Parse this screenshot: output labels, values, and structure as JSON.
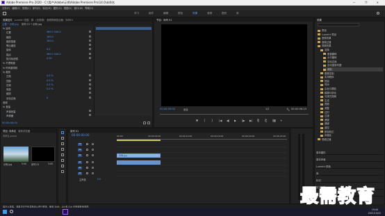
{
  "window": {
    "title": "Adobe Premiere Pro 2020 - C:\\用户\\Adobe\\示例\\Adobe Premiere Pro\\14.0\\未命名",
    "controls": "— ❐ ✕"
  },
  "menu": [
    "文件(F)",
    "编辑(E)",
    "剪辑(C)",
    "序列(S)",
    "标记(M)",
    "图形(G)",
    "视图(V)",
    "窗口(W)",
    "帮助(H)"
  ],
  "workspaces": [
    "学习",
    "组件",
    "编辑",
    "颜色",
    "效果",
    "音频",
    "图形",
    "库"
  ],
  "workspace_active": "效果",
  "effect_controls": {
    "tabs": [
      "效果控件",
      "Lumetri 范围",
      "源：(无剪辑)",
      "音频剪辑混合器：序列01"
    ],
    "header": [
      "主要 * 示例.jpg",
      "序列 01 * 示例.jpg"
    ],
    "rows": [
      {
        "label": "fx 运动",
        "value": ""
      },
      {
        "label": "位置",
        "value": "960.0   540.0"
      },
      {
        "label": "缩放",
        "value": "100.0"
      },
      {
        "label": "缩放宽度",
        "value": "100.0"
      },
      {
        "label": "等比缩放",
        "value": ""
      },
      {
        "label": "旋转",
        "value": "0.0"
      },
      {
        "label": "锚点",
        "value": "960.0   540.0"
      },
      {
        "label": "防闪烁滤镜",
        "value": "0.00"
      },
      {
        "label": "fx 不透明度",
        "value": ""
      },
      {
        "label": "fx 时间重映射",
        "value": ""
      },
      {
        "label": "fx 裁剪",
        "value": ""
      },
      {
        "label": "左侧",
        "value": "0.0 %"
      },
      {
        "label": "顶部",
        "value": "0.0 %"
      },
      {
        "label": "右侧",
        "value": "0.0 %"
      },
      {
        "label": "底部",
        "value": "0.0 %"
      },
      {
        "label": "缩放",
        "value": ""
      },
      {
        "label": "羽化边缘",
        "value": "0"
      },
      {
        "label": "音频",
        "value": ""
      },
      {
        "label": "fx 音量",
        "value": ""
      },
      {
        "label": "声道音量",
        "value": ""
      },
      {
        "label": "声像器",
        "value": ""
      }
    ],
    "timecode": "00:00:00:00"
  },
  "program": {
    "tab": "节目：序列 01",
    "timecode": "00:00:00:00",
    "fit": "适合",
    "ratio": "1/2",
    "duration": "00:00:06:24"
  },
  "effects_panel": {
    "tab": "效果",
    "items": [
      {
        "label": "预设",
        "indent": 1
      },
      {
        "label": "Lumetri 预设",
        "indent": 1
      },
      {
        "label": "音频效果",
        "indent": 1
      },
      {
        "label": "音频过渡",
        "indent": 1
      },
      {
        "label": "视频效果",
        "indent": 1
      },
      {
        "label": "变换",
        "indent": 2
      },
      {
        "label": "垂直翻转",
        "indent": 3
      },
      {
        "label": "水平翻转",
        "indent": 3
      },
      {
        "label": "羽化边缘",
        "indent": 3
      },
      {
        "label": "自动重新构图",
        "indent": 3
      },
      {
        "label": "裁剪",
        "indent": 3,
        "selected": true
      },
      {
        "label": "图像控制",
        "indent": 2
      },
      {
        "label": "实用程序",
        "indent": 2
      },
      {
        "label": "扭曲",
        "indent": 2
      },
      {
        "label": "时间",
        "indent": 2
      },
      {
        "label": "杂色与颗粒",
        "indent": 2
      },
      {
        "label": "模糊与锐化",
        "indent": 2
      },
      {
        "label": "沉浸式视频",
        "indent": 2
      },
      {
        "label": "生成",
        "indent": 2
      },
      {
        "label": "视频",
        "indent": 2
      },
      {
        "label": "调整",
        "indent": 2
      },
      {
        "label": "过时",
        "indent": 2
      },
      {
        "label": "过渡",
        "indent": 2
      },
      {
        "label": "透视",
        "indent": 2
      },
      {
        "label": "通道",
        "indent": 2
      },
      {
        "label": "键控",
        "indent": 2
      },
      {
        "label": "颜色校正",
        "indent": 2
      },
      {
        "label": "风格化",
        "indent": 2
      },
      {
        "label": "视频过渡",
        "indent": 1
      }
    ],
    "lower_items": [
      "基本图形",
      "基本声音",
      "Lumetri 颜色",
      "库",
      "标记",
      "历史记录",
      "信息"
    ]
  },
  "project": {
    "tabs": [
      "项目: 未命名",
      "媒体浏览器"
    ],
    "search_placeholder": "未命名.prproj",
    "thumbs": [
      {
        "label": "示例.jpg",
        "duration": "5:00"
      },
      {
        "label": "序列 01",
        "duration": "5:00"
      }
    ]
  },
  "timeline": {
    "tab": "序列 01",
    "timecode": "00:00:00:00",
    "ruler": [
      "00:00",
      "00:00:05:00",
      "00:00:10:00",
      "00:00:15:00",
      "00:00:20:00",
      "00:00:25:00"
    ],
    "tracks": [
      "V3",
      "V2",
      "V1",
      "A1",
      "A2",
      "A3"
    ],
    "master": "主声道",
    "master_val": "0.0",
    "clips": [
      {
        "label": "示例.jpg",
        "track": "V1"
      },
      {
        "label": "",
        "track": "A1"
      }
    ]
  },
  "status": "单击以选择，或单击空白处并拖动以进行框选。使用 Shift、Alt 和 Ctrl 可获得其他选项。",
  "watermark": "最需教育",
  "taskbar": {
    "time": "19:44",
    "date": "2021/10/22"
  },
  "colors": {
    "accent": "#4e8ff0",
    "clip_video": "#8fb5e8",
    "clip_audio": "#6e8fc4"
  }
}
